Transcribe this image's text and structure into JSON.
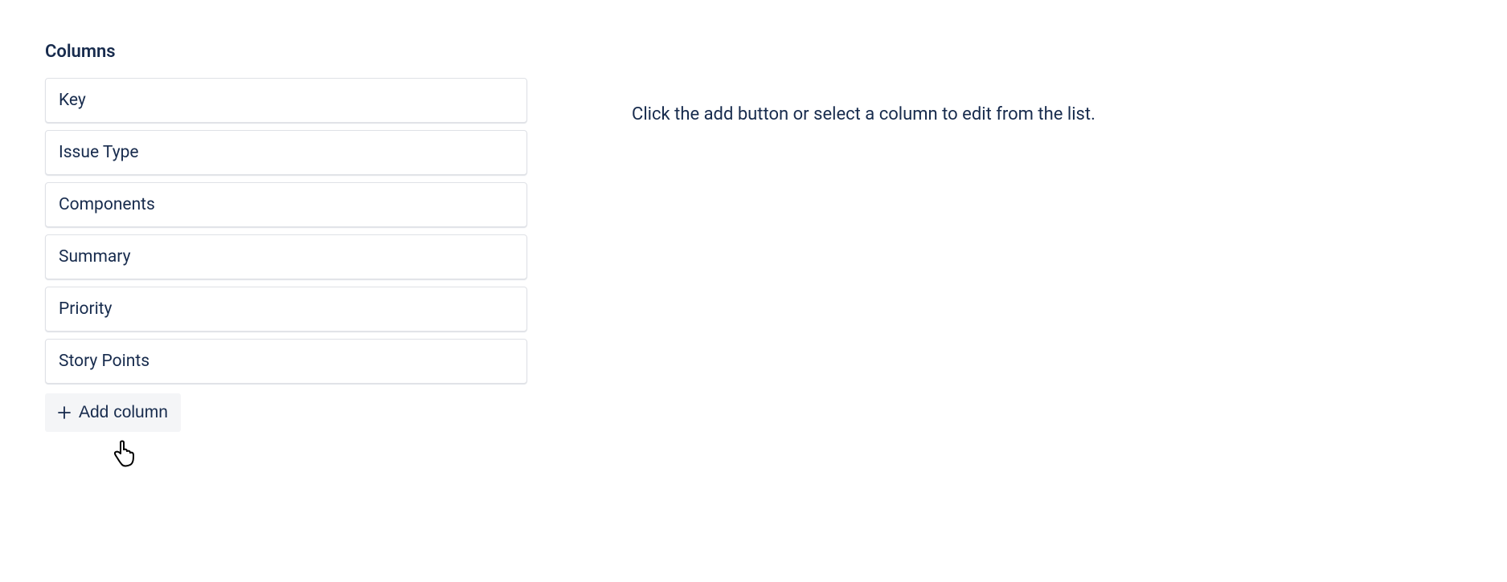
{
  "heading": "Columns",
  "columns": [
    {
      "label": "Key"
    },
    {
      "label": "Issue Type"
    },
    {
      "label": "Components"
    },
    {
      "label": "Summary"
    },
    {
      "label": "Priority"
    },
    {
      "label": "Story Points"
    }
  ],
  "addButton": {
    "label": "Add column"
  },
  "hint": "Click the add button or select a column to edit from the list."
}
